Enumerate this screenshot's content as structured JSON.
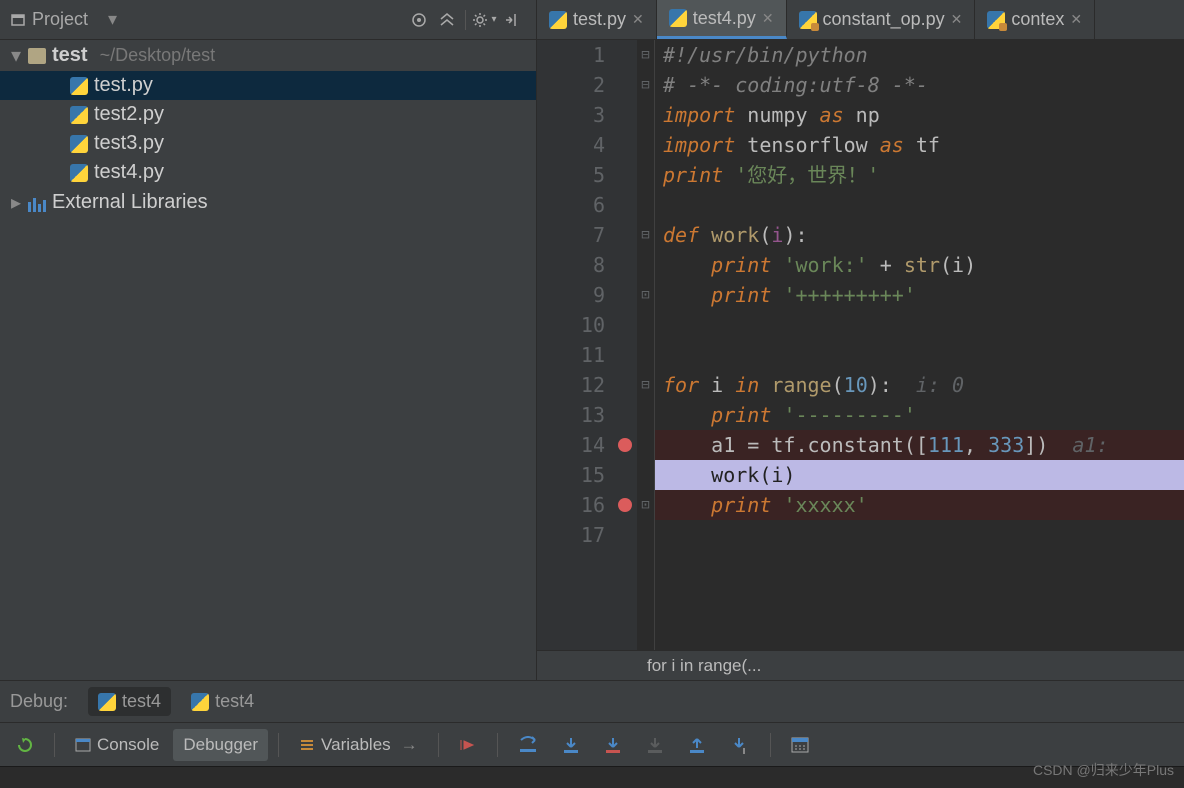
{
  "project": {
    "label": "Project",
    "root": "test",
    "root_path": "~/Desktop/test",
    "files": [
      "test.py",
      "test2.py",
      "test3.py",
      "test4.py"
    ],
    "external": "External Libraries"
  },
  "tabs": [
    {
      "label": "test.py",
      "active": false,
      "locked": false
    },
    {
      "label": "test4.py",
      "active": true,
      "locked": false
    },
    {
      "label": "constant_op.py",
      "active": false,
      "locked": true
    },
    {
      "label": "contex",
      "active": false,
      "locked": true
    }
  ],
  "code": {
    "lines": [
      {
        "n": 1,
        "html": "<span class='cm'>#!/usr/bin/python</span>"
      },
      {
        "n": 2,
        "html": "<span class='cm'># -*- coding:utf-8 -*-</span>"
      },
      {
        "n": 3,
        "html": "<span class='kw'>import</span> numpy <span class='kw'>as</span> np"
      },
      {
        "n": 4,
        "html": "<span class='kw'>import</span> tensorflow <span class='kw'>as</span> tf"
      },
      {
        "n": 5,
        "html": "<span class='kw'>print</span> <span class='str'>'您好，世界！'</span>"
      },
      {
        "n": 6,
        "html": ""
      },
      {
        "n": 7,
        "html": "<span class='kw'>def</span> <span class='call'>work</span>(<span class='self'>i</span>):"
      },
      {
        "n": 8,
        "html": "    <span class='kw'>print</span> <span class='str'>'work:'</span> + <span class='call'>str</span>(i)"
      },
      {
        "n": 9,
        "html": "    <span class='kw'>print</span> <span class='str'>'+++++++++'</span>"
      },
      {
        "n": 10,
        "html": ""
      },
      {
        "n": 11,
        "html": ""
      },
      {
        "n": 12,
        "html": "<span class='kw'>for</span> i <span class='kw'>in</span> <span class='call'>range</span>(<span class='num'>10</span>):  <span class='hint'>i: 0</span>"
      },
      {
        "n": 13,
        "html": "    <span class='kw'>print</span> <span class='str'>'---------'</span>"
      },
      {
        "n": 14,
        "html": "    a1 = tf.constant([<span class='num'>111</span>, <span class='num'>333</span>])  <span class='hint'>a1:</span>",
        "bp": true
      },
      {
        "n": 15,
        "html": "    work(i)",
        "current": true
      },
      {
        "n": 16,
        "html": "    <span class='kw'>print</span> <span class='str'>'xxxxx'</span>",
        "bp": true
      },
      {
        "n": 17,
        "html": ""
      }
    ],
    "breadcrumb": "for i in range(..."
  },
  "debug": {
    "label": "Debug:",
    "configs": [
      "test4",
      "test4"
    ],
    "tabs": {
      "console": "Console",
      "debugger": "Debugger",
      "variables": "Variables"
    }
  },
  "watermark": "CSDN @归来少年Plus"
}
